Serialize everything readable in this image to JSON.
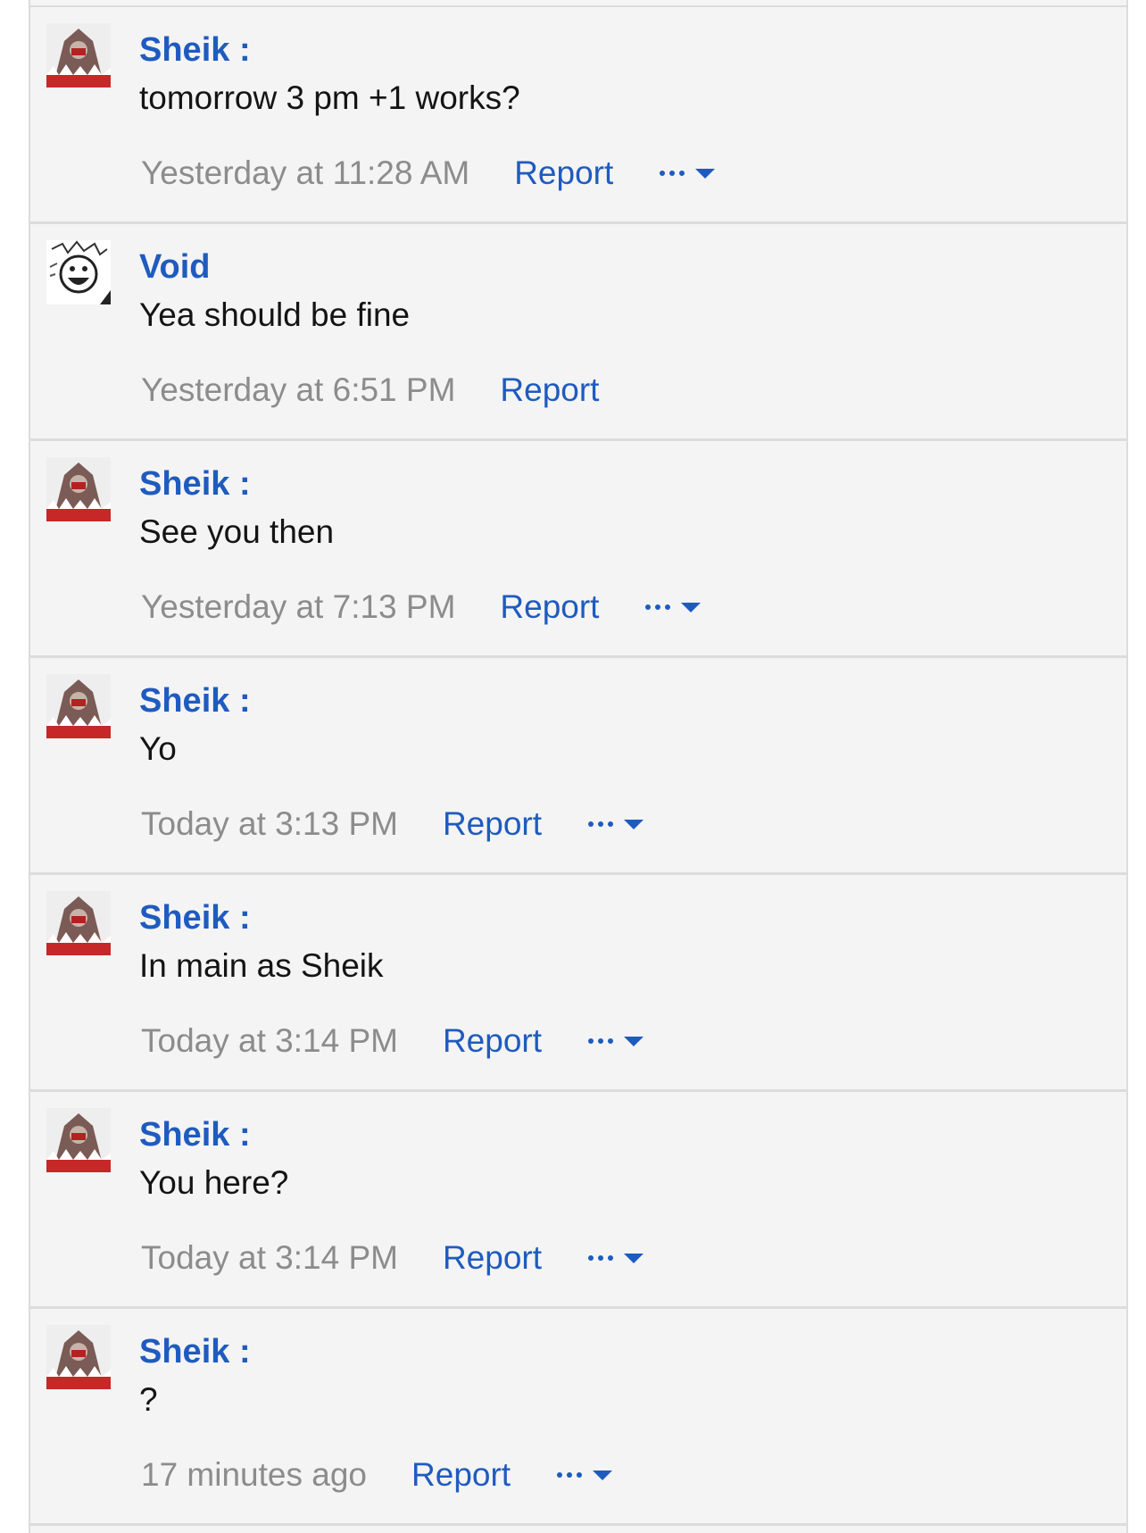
{
  "colors": {
    "link_blue": "#1f5bbf",
    "timestamp_gray": "#8c8c8c",
    "background": "#f4f4f4",
    "divider": "#dcdcdc"
  },
  "messages": [
    {
      "author": "Sheik :",
      "text": "tomorrow 3 pm +1 works?",
      "time": "Yesterday at 11:28 AM",
      "report": "Report",
      "has_more": true,
      "avatar": "sheik-avatar"
    },
    {
      "author": "Void",
      "text": "Yea should be fine",
      "time": "Yesterday at 6:51 PM",
      "report": "Report",
      "has_more": false,
      "avatar": "void-avatar"
    },
    {
      "author": "Sheik :",
      "text": "See you then",
      "time": "Yesterday at 7:13 PM",
      "report": "Report",
      "has_more": true,
      "avatar": "sheik-avatar"
    },
    {
      "author": "Sheik :",
      "text": "Yo",
      "time": "Today at 3:13 PM",
      "report": "Report",
      "has_more": true,
      "avatar": "sheik-avatar"
    },
    {
      "author": "Sheik :",
      "text": "In main as Sheik",
      "time": "Today at 3:14 PM",
      "report": "Report",
      "has_more": true,
      "avatar": "sheik-avatar"
    },
    {
      "author": "Sheik :",
      "text": "You here?",
      "time": "Today at 3:14 PM",
      "report": "Report",
      "has_more": true,
      "avatar": "sheik-avatar"
    },
    {
      "author": "Sheik :",
      "text": "?",
      "time": "17 minutes ago",
      "report": "Report",
      "has_more": true,
      "avatar": "sheik-avatar"
    }
  ]
}
